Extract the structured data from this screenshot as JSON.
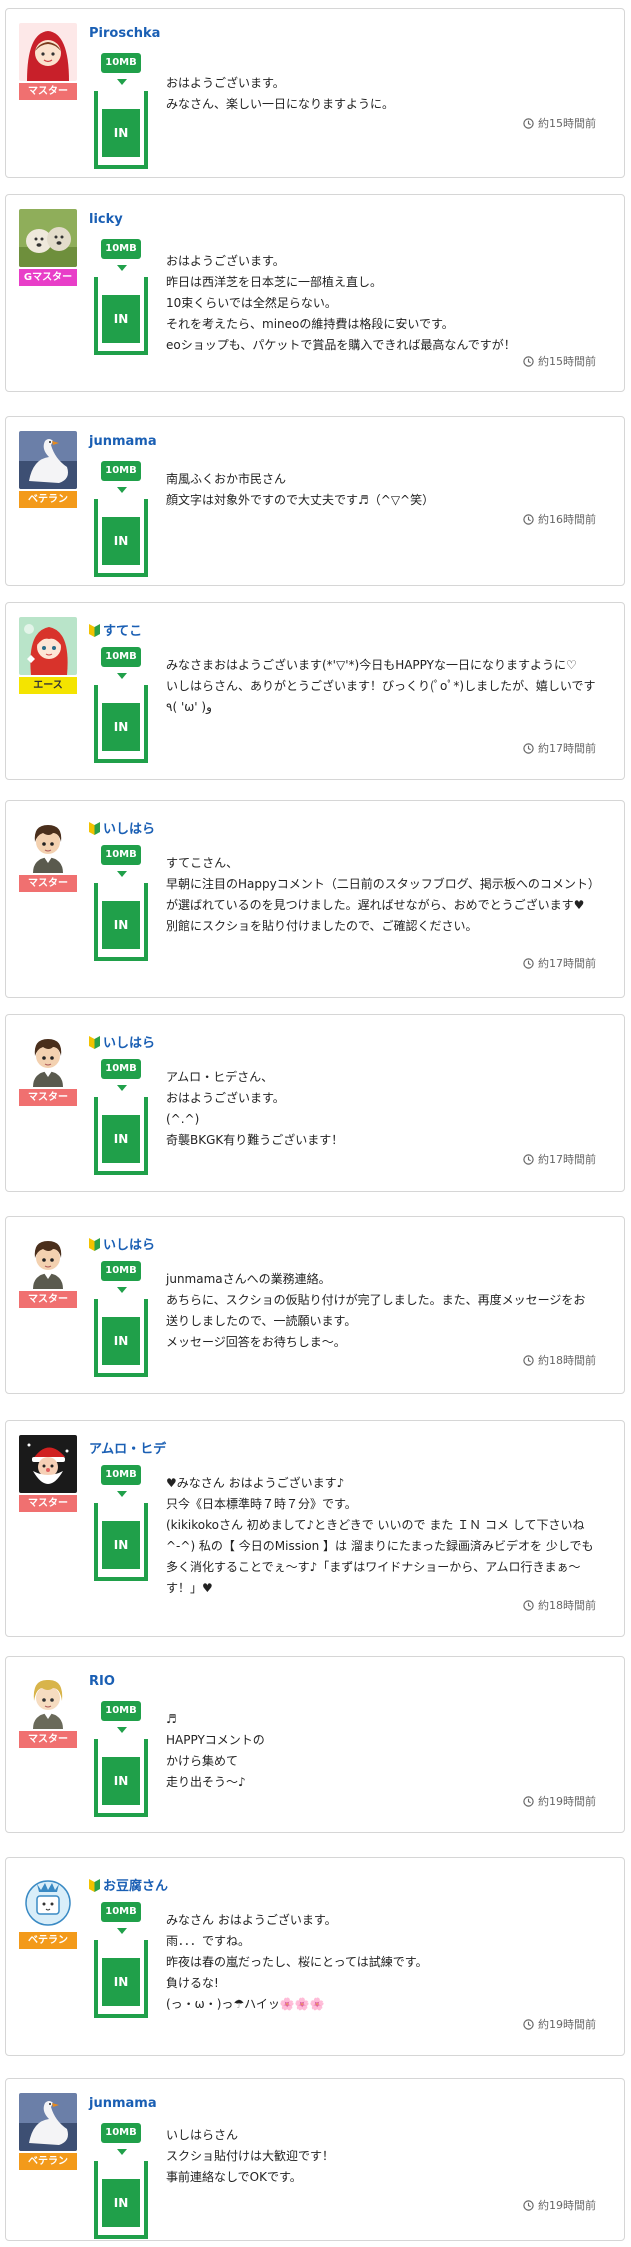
{
  "posts": [
    {
      "username": "Piroschka",
      "beginner": false,
      "rank": "マスター",
      "rank_style": "master",
      "avatar": "red-hood",
      "data_badge": "10MB",
      "status": "IN",
      "text": "おはようございます。\nみなさん、楽しい一日になりますように。",
      "time": "約15時間前"
    },
    {
      "username": "licky",
      "beginner": false,
      "rank": "Gマスター",
      "rank_style": "gmaster",
      "avatar": "dogs",
      "data_badge": "10MB",
      "status": "IN",
      "text": "おはようございます。\n昨日は西洋芝を日本芝に一部植え直し。\n10束くらいでは全然足らない。\nそれを考えたら、mineoの維持費は格段に安いです。\neoショップも、パケットで賞品を購入できれば最高なんですが！",
      "time": "約15時間前"
    },
    {
      "username": "junmama",
      "beginner": false,
      "rank": "ベテラン",
      "rank_style": "veteran",
      "avatar": "swan",
      "data_badge": "10MB",
      "status": "IN",
      "text": "南風ふくおか市民さん\n顔文字は対象外ですので大丈夫です♬（^▽^笑）",
      "time": "約16時間前"
    },
    {
      "username": "すてこ",
      "beginner": true,
      "rank": "エース",
      "rank_style": "ace",
      "avatar": "redhair",
      "data_badge": "10MB",
      "status": "IN",
      "text": "みなさまおはようございます(*'▽'*)今日もHAPPYな一日になりますように♡\nいしはらさん、ありがとうございます！びっくり(ﾟoﾟ*)しましたが、嬉しいです٩( 'ω' )و",
      "time": "約17時間前"
    },
    {
      "username": "いしはら",
      "beginner": true,
      "rank": "マスター",
      "rank_style": "master",
      "avatar": "boy",
      "data_badge": "10MB",
      "status": "IN",
      "text": "すてこさん、\n早朝に注目のHappyコメント（二日前のスタッフブログ、掲示板へのコメント）が選ばれているのを見つけました。遅ればせながら、おめでとうございます♥\n別館にスクショを貼り付けましたので、ご確認ください。",
      "time": "約17時間前"
    },
    {
      "username": "いしはら",
      "beginner": true,
      "rank": "マスター",
      "rank_style": "master",
      "avatar": "boy",
      "data_badge": "10MB",
      "status": "IN",
      "text": "アムロ・ヒデさん、\nおはようございます。\n(^.^)\n奇襲BKGK有り難うございます！",
      "time": "約17時間前"
    },
    {
      "username": "いしはら",
      "beginner": true,
      "rank": "マスター",
      "rank_style": "master",
      "avatar": "boy",
      "data_badge": "10MB",
      "status": "IN",
      "text": "junmamaさんへの業務連絡。\nあちらに、スクショの仮貼り付けが完了しました。また、再度メッセージをお送りしましたので、一読願います。\nメッセージ回答をお待ちしま～。",
      "time": "約18時間前"
    },
    {
      "username": "アムロ・ヒデ",
      "beginner": false,
      "rank": "マスター",
      "rank_style": "master",
      "avatar": "santa",
      "data_badge": "10MB",
      "status": "IN",
      "text": "♥みなさん おはようございます♪\n只今《日本標準時７時７分》です。\n(kikikokoさん 初めまして♪ときどきで いいので また ＩＮ コメ して下さいね ^-^) 私の【 今日のMission 】は 溜まりにたまった録画済みビデオを 少しでも多く消化することでぇ～す♪「まずはワイドナショーから、アムロ行きまぁ～す！」♥",
      "time": "約18時間前"
    },
    {
      "username": "RIO",
      "beginner": false,
      "rank": "マスター",
      "rank_style": "master",
      "avatar": "blonde",
      "data_badge": "10MB",
      "status": "IN",
      "text": "♬\nHAPPYコメントの\nかけら集めて\n走り出そう～♪",
      "time": "約19時間前"
    },
    {
      "username": "お豆腐さん",
      "beginner": true,
      "rank": "ベテラン",
      "rank_style": "veteran",
      "avatar": "tofu",
      "data_badge": "10MB",
      "status": "IN",
      "text": "みなさん おはようございます。\n雨．．．ですね。\n昨夜は春の嵐だったし、桜にとっては試練です。\n負けるな!\n(っ・ω・)っ☂ハイッ🌸🌸🌸",
      "time": "約19時間前"
    },
    {
      "username": "junmama",
      "beginner": false,
      "rank": "ベテラン",
      "rank_style": "veteran",
      "avatar": "swan",
      "data_badge": "10MB",
      "status": "IN",
      "text": "いしはらさん\nスクショ貼付けは大歓迎です！\n事前連絡なしでOKです。",
      "time": "約19時間前"
    }
  ]
}
